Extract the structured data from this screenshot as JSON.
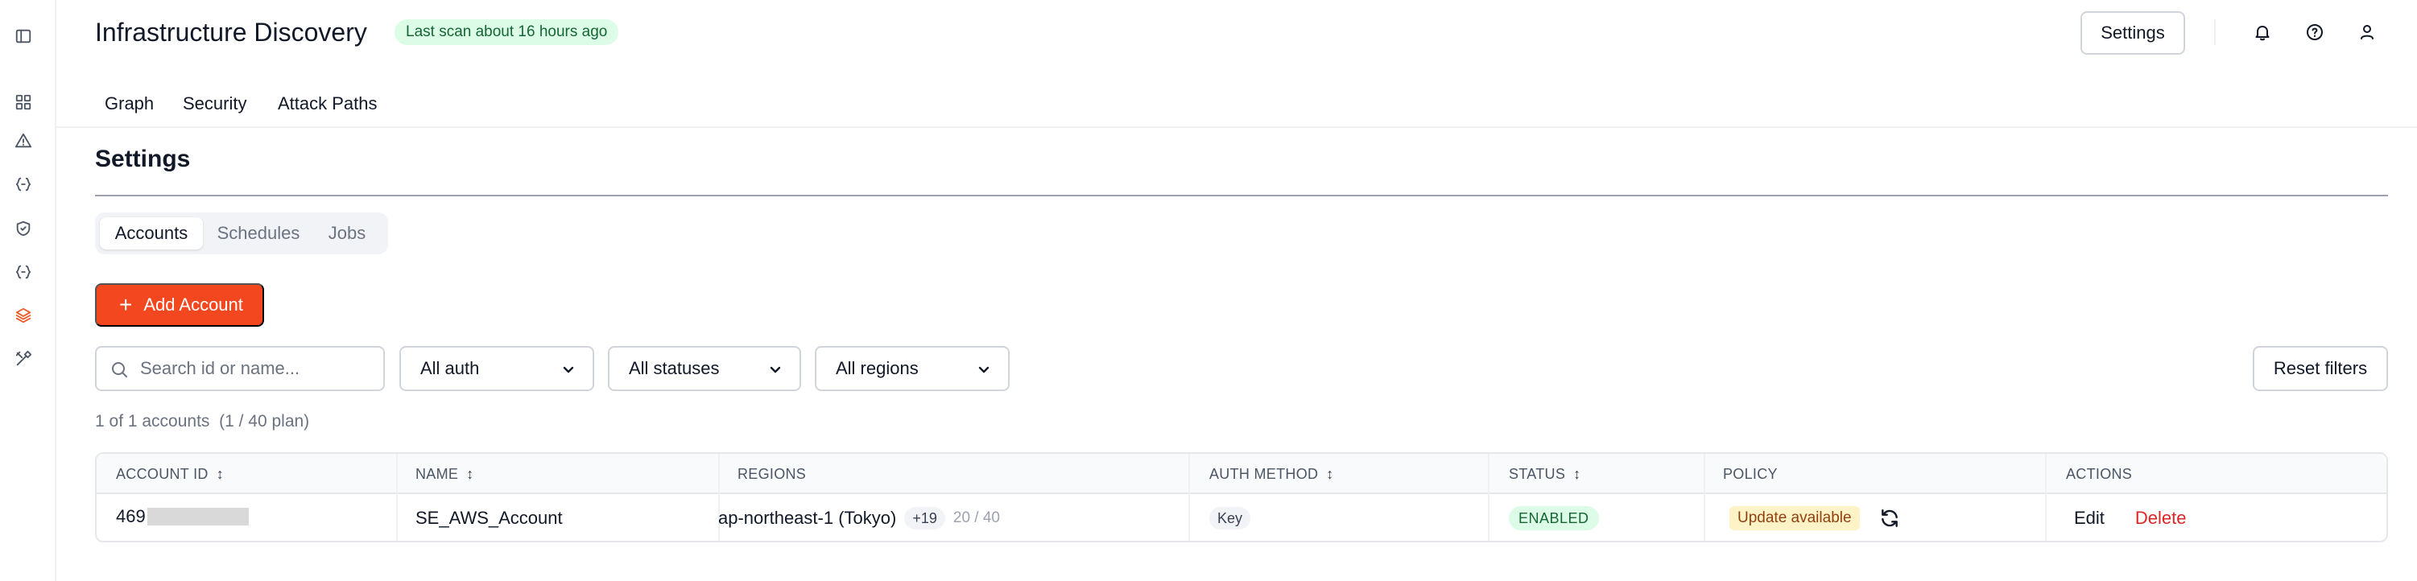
{
  "header": {
    "title": "Infrastructure Discovery",
    "scan_badge": "Last scan about 16 hours ago",
    "settings_label": "Settings"
  },
  "rail_icons": [
    "panel-toggle-icon",
    "dashboard-grid-icon",
    "alert-triangle-icon",
    "braces-icon",
    "shield-icon",
    "braces-icon",
    "layers-icon",
    "tools-icon"
  ],
  "top_tabs": [
    "Graph",
    "Security",
    "Attack Paths"
  ],
  "section": {
    "title": "Settings",
    "segments": [
      "Accounts",
      "Schedules",
      "Jobs"
    ],
    "selected_segment": "Accounts"
  },
  "toolbar": {
    "add_account_label": "Add Account",
    "search_placeholder": "Search id or name...",
    "auth_filter": "All auth",
    "status_filter": "All statuses",
    "region_filter": "All regions",
    "reset_label": "Reset filters"
  },
  "summary": {
    "count_text": "1 of 1 accounts",
    "plan_text": "(1 / 40 plan)"
  },
  "table": {
    "columns": [
      {
        "label": "ACCOUNT ID",
        "sortable": true
      },
      {
        "label": "NAME",
        "sortable": true
      },
      {
        "label": "REGIONS",
        "sortable": false
      },
      {
        "label": "AUTH METHOD",
        "sortable": true
      },
      {
        "label": "STATUS",
        "sortable": true
      },
      {
        "label": "POLICY",
        "sortable": false
      },
      {
        "label": "ACTIONS",
        "sortable": false
      }
    ],
    "sort_glyph": "↕",
    "rows": [
      {
        "account_id_prefix": "469",
        "name": "SE_AWS_Account",
        "region_primary": "ap-northeast-1 (Tokyo)",
        "region_more": "+19",
        "region_count": "20 / 40",
        "auth_method": "Key",
        "status": "ENABLED",
        "policy": "Update available",
        "edit_label": "Edit",
        "delete_label": "Delete"
      }
    ]
  },
  "colors": {
    "accent": "#f2471f",
    "success_bg": "#dcfce7",
    "success_text": "#166534",
    "warning_bg": "#fef3c7",
    "danger_text": "#dc2626"
  }
}
